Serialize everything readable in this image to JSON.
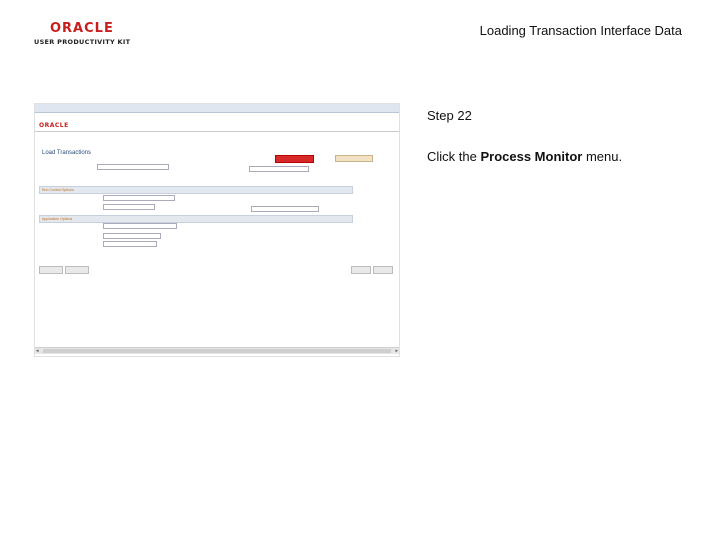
{
  "logo": {
    "brand": "ORACLE",
    "product": "USER PRODUCTIVITY KIT"
  },
  "header": {
    "title": "Loading Transaction Interface Data"
  },
  "step": {
    "label": "Step 22"
  },
  "instruction": {
    "prefix": "Click the ",
    "target": "Process Monitor",
    "suffix": " menu."
  },
  "screenshot": {
    "brand": "ORACLE",
    "page_title": "Load Transactions",
    "sections": [
      "Run Control Options",
      "Application Options"
    ]
  }
}
